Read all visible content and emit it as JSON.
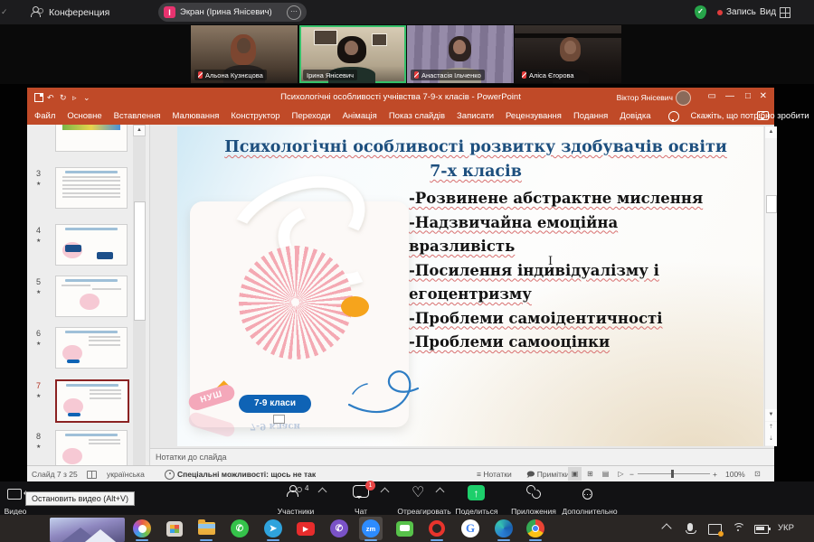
{
  "colors": {
    "ppt_accent": "#c04a28",
    "active_speaker_border": "#35c06a",
    "record_red": "#e03c3c",
    "share_green": "#1dcf6b",
    "chat_badge_red": "#e94646",
    "zoom_blue": "#2d8cff",
    "slide_title_blue": "#1d4f7e",
    "grade_pill_blue": "#0f63b5",
    "nush_pink": "#f4a8ba",
    "sunburst_pink": "#f4a9b3",
    "accent_orange": "#f6a41c"
  },
  "zoom_app": {
    "top_bar": {
      "meeting_label": "Конференция",
      "share_pill_label": "Экран (Ірина Янісевич)",
      "share_badge": "І",
      "record_label": "Запись",
      "view_label": "Вид"
    },
    "participants": [
      {
        "name": "Альона Кузнєцова",
        "muted": true
      },
      {
        "name": "Ірина Янісевич",
        "muted": false,
        "active_speaker": true
      },
      {
        "name": "Анастасія Ільченко",
        "muted": true
      },
      {
        "name": "Аліса Єгорова",
        "muted": true
      }
    ],
    "toolbar": {
      "video_label": "Видео",
      "video_tooltip": "Остановить видео (Alt+V)",
      "participants_label": "Участники",
      "participants_count": "4",
      "chat_label": "Чат",
      "chat_badge": "1",
      "react_label": "Отреагировать",
      "share_label": "Поделиться",
      "apps_label": "Приложения",
      "more_label": "Дополнительно"
    }
  },
  "powerpoint": {
    "title_bar": {
      "document_title": "Психологічні особливості учнівства 7-9-х класів - PowerPoint",
      "user_name": "Віктор Янісевич"
    },
    "ribbon_tabs": [
      "Файл",
      "Основне",
      "Вставлення",
      "Малювання",
      "Конструктор",
      "Переходи",
      "Анімація",
      "Показ слайдів",
      "Записати",
      "Рецензування",
      "Подання",
      "Довідка"
    ],
    "tell_me": "Скажіть, що потрібно зробити",
    "thumbnails": [
      {
        "num": "3"
      },
      {
        "num": "4"
      },
      {
        "num": "5"
      },
      {
        "num": "6"
      },
      {
        "num": "7"
      },
      {
        "num": "8"
      }
    ],
    "slide": {
      "title_line1": "Психологічні особливості розвитку здобувачів освіти",
      "title_line2": "7-х класів",
      "bullets": [
        "-Розвинене абстрактне мислення",
        "-Надзвичайна емоційна вразливість",
        "-Посилення індивідуалізму і егоцентризму",
        "-Проблеми самоідентичності",
        "-Проблеми самооцінки"
      ],
      "nush_label": "НУШ",
      "grade_pill_label": "7-9 класи",
      "grade_pill_reflection": "7-9 класи"
    },
    "notes_label": "Нотатки до слайда",
    "status_bar": {
      "slide_counter": "Слайд 7 з 25",
      "language": "українська",
      "accessibility": "Спеціальні можливості: щось не так",
      "notes_label": "Нотатки",
      "comments_label": "Примітки",
      "zoom_level": "100%"
    }
  },
  "taskbar": {
    "language_indicator": "УКР",
    "pinned_apps": [
      "widgets",
      "copilot",
      "microsoft-store",
      "file-explorer",
      "whatsapp",
      "telegram",
      "youtube",
      "viber",
      "zoom",
      "messages",
      "opera",
      "google",
      "edge",
      "chrome"
    ],
    "tray_items": [
      "hidden-icons-chevron",
      "microphone",
      "screen-cast",
      "wifi",
      "battery",
      "language"
    ]
  }
}
